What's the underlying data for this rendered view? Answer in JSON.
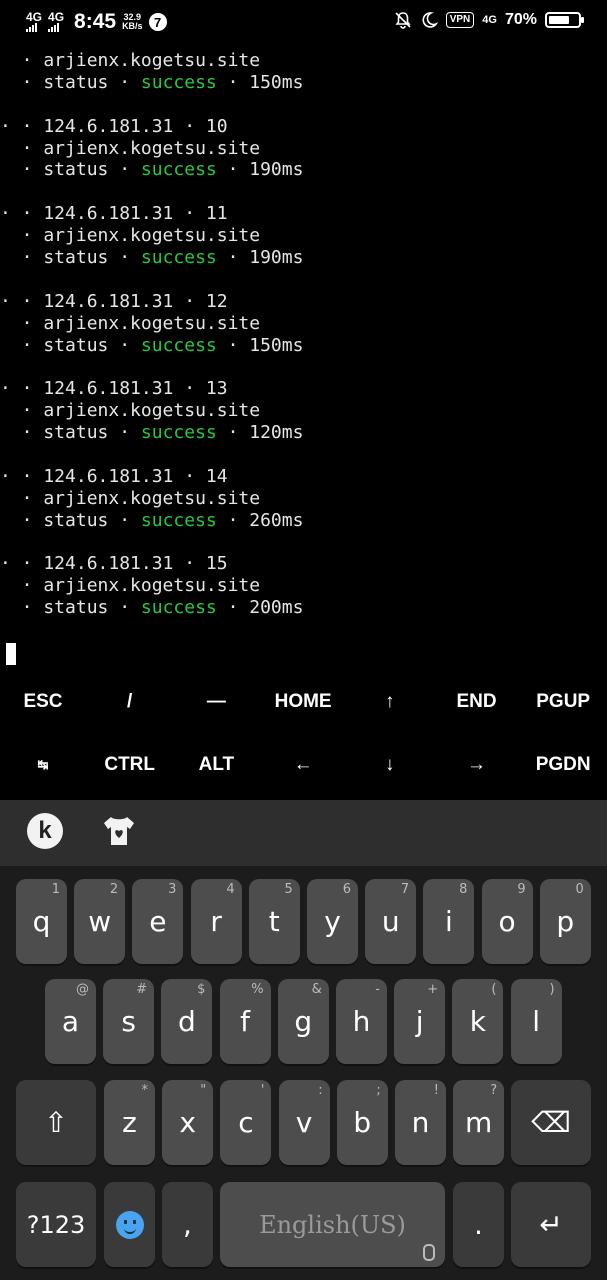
{
  "statusbar": {
    "net1": "4G",
    "net2": "4G",
    "time": "8:45",
    "speed_value": "32.9",
    "speed_unit": "KB/s",
    "notification_count": "7",
    "vpn": "VPN",
    "net3": "4G",
    "battery": "70%",
    "battery_level": 0.7
  },
  "terminal": {
    "lines": [
      {
        "text": "  · arjienx.kogetsu.site"
      },
      {
        "pre": "  · status · ",
        "status": "success",
        "post": " · 150ms"
      },
      {
        "gap": true
      },
      {
        "text": "· · 124.6.181.31 · 10"
      },
      {
        "text": "  · arjienx.kogetsu.site"
      },
      {
        "pre": "  · status · ",
        "status": "success",
        "post": " · 190ms"
      },
      {
        "gap": true
      },
      {
        "text": "· · 124.6.181.31 · 11"
      },
      {
        "text": "  · arjienx.kogetsu.site"
      },
      {
        "pre": "  · status · ",
        "status": "success",
        "post": " · 190ms"
      },
      {
        "gap": true
      },
      {
        "text": "· · 124.6.181.31 · 12"
      },
      {
        "text": "  · arjienx.kogetsu.site"
      },
      {
        "pre": "  · status · ",
        "status": "success",
        "post": " · 150ms"
      },
      {
        "gap": true
      },
      {
        "text": "· · 124.6.181.31 · 13"
      },
      {
        "text": "  · arjienx.kogetsu.site"
      },
      {
        "pre": "  · status · ",
        "status": "success",
        "post": " · 120ms"
      },
      {
        "gap": true
      },
      {
        "text": "· · 124.6.181.31 · 14"
      },
      {
        "text": "  · arjienx.kogetsu.site"
      },
      {
        "pre": "  · status · ",
        "status": "success",
        "post": " · 260ms"
      },
      {
        "gap": true
      },
      {
        "text": "· · 124.6.181.31 · 15"
      },
      {
        "text": "  · arjienx.kogetsu.site"
      },
      {
        "pre": "  · status · ",
        "status": "success",
        "post": " · 200ms"
      }
    ],
    "success_color": "#27c93f"
  },
  "extra_keys": {
    "row1": [
      "ESC",
      "/",
      "—",
      "HOME",
      "↑",
      "END",
      "PGUP"
    ],
    "row2": [
      "↹",
      "CTRL",
      "ALT",
      "←",
      "↓",
      "→",
      "PGDN"
    ]
  },
  "keyboard": {
    "toolbar_logo": "k",
    "row1": [
      {
        "key": "q",
        "hint": "1"
      },
      {
        "key": "w",
        "hint": "2"
      },
      {
        "key": "e",
        "hint": "3"
      },
      {
        "key": "r",
        "hint": "4"
      },
      {
        "key": "t",
        "hint": "5"
      },
      {
        "key": "y",
        "hint": "6"
      },
      {
        "key": "u",
        "hint": "7"
      },
      {
        "key": "i",
        "hint": "8"
      },
      {
        "key": "o",
        "hint": "9"
      },
      {
        "key": "p",
        "hint": "0"
      }
    ],
    "row2": [
      {
        "key": "a",
        "hint": "@"
      },
      {
        "key": "s",
        "hint": "#"
      },
      {
        "key": "d",
        "hint": "$"
      },
      {
        "key": "f",
        "hint": "%"
      },
      {
        "key": "g",
        "hint": "&"
      },
      {
        "key": "h",
        "hint": "-"
      },
      {
        "key": "j",
        "hint": "+"
      },
      {
        "key": "k",
        "hint": "("
      },
      {
        "key": "l",
        "hint": ")"
      }
    ],
    "row3": [
      {
        "key": "z",
        "hint": "*"
      },
      {
        "key": "x",
        "hint": "\""
      },
      {
        "key": "c",
        "hint": "'"
      },
      {
        "key": "v",
        "hint": ":"
      },
      {
        "key": "b",
        "hint": ";"
      },
      {
        "key": "n",
        "hint": "!"
      },
      {
        "key": "m",
        "hint": "?"
      }
    ],
    "shift": "⇧",
    "backspace": "⌫",
    "symbols": "?123",
    "comma": ",",
    "space": "English(US)",
    "period": ".",
    "enter": "↵"
  }
}
